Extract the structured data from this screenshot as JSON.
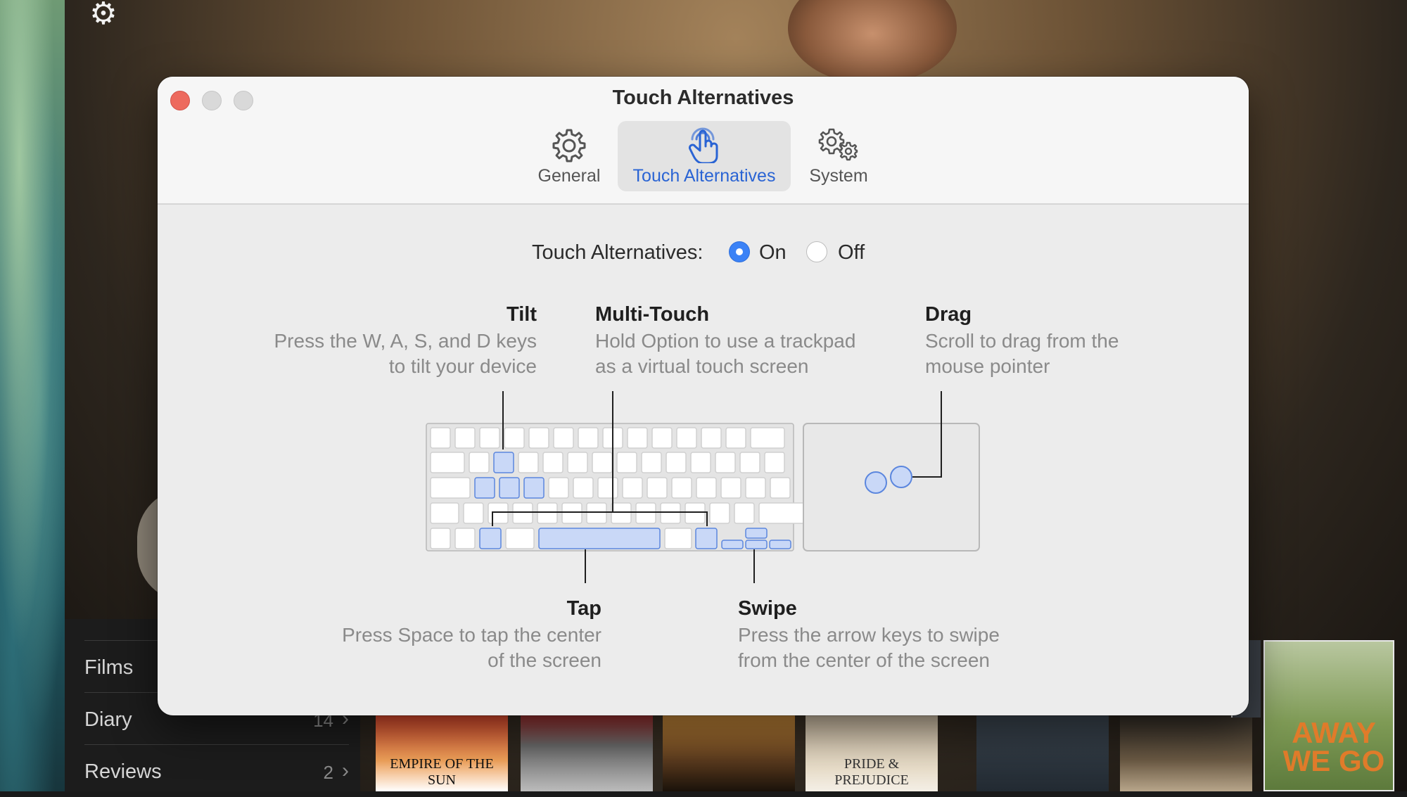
{
  "dialog": {
    "title": "Touch Alternatives",
    "tabs": [
      {
        "label": "General",
        "icon": "gear-icon"
      },
      {
        "label": "Touch Alternatives",
        "icon": "hand-pointer-icon",
        "selected": true
      },
      {
        "label": "System",
        "icon": "gears-icon"
      }
    ],
    "toggle": {
      "label": "Touch Alternatives:",
      "options": [
        "On",
        "Off"
      ],
      "selected": "On"
    },
    "features": {
      "tilt": {
        "title": "Tilt",
        "desc_line1": "Press the W, A, S, and D keys",
        "desc_line2": "to tilt your device"
      },
      "multi_touch": {
        "title": "Multi-Touch",
        "desc_line1": "Hold Option to use a trackpad",
        "desc_line2": "as a virtual touch screen"
      },
      "drag": {
        "title": "Drag",
        "desc_line1": "Scroll to drag from the",
        "desc_line2": "mouse pointer"
      },
      "tap": {
        "title": "Tap",
        "desc_line1": "Press Space to tap the center",
        "desc_line2": "of the screen"
      },
      "swipe": {
        "title": "Swipe",
        "desc_line1": "Press the arrow keys to swipe",
        "desc_line2": "from the center of the screen"
      }
    },
    "colors": {
      "accent": "#3b82f6",
      "key_highlight": "#c9d8f7"
    }
  },
  "background": {
    "sidebar": [
      {
        "label": "Films",
        "count": ""
      },
      {
        "label": "Diary",
        "count": "14"
      },
      {
        "label": "Reviews",
        "count": "2"
      }
    ],
    "posters": [
      {
        "title": "EMPIRE OF THE SUN"
      },
      {
        "title": ""
      },
      {
        "title": ""
      },
      {
        "title": "PRIDE & PREJUDICE"
      },
      {
        "title": ""
      },
      {
        "title": ""
      }
    ],
    "poster_away_title": "AWAY WE GO"
  }
}
